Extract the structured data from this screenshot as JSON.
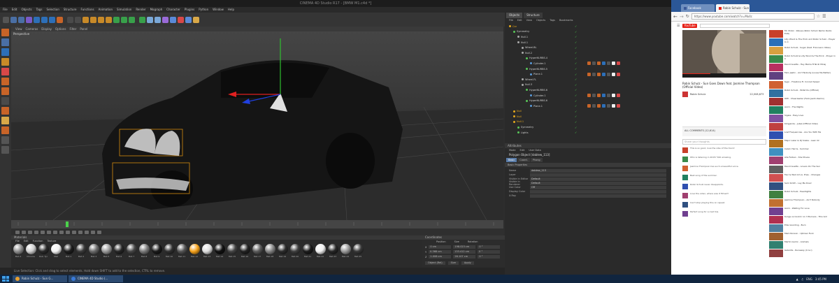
{
  "c4d": {
    "title": "CINEMA 4D Studio R17 - [BMW M1.c4d *]",
    "menu": [
      "File",
      "Edit",
      "Objects",
      "Tags",
      "Selection",
      "Structure",
      "Functions",
      "Animation",
      "Simulation",
      "Render",
      "Mograph",
      "Character",
      "Plugins",
      "Python",
      "Window",
      "Help"
    ],
    "viewport_menu": [
      "View",
      "Cameras",
      "Display",
      "Options",
      "Filter",
      "Panel"
    ],
    "viewport_label": "Perspective",
    "status": "Live Selection: Click and drag to select elements. Hold down SHIFT to add to the selection, CTRL to remove."
  },
  "object_manager": {
    "tabs": [
      "Objects",
      "Structure"
    ],
    "menu": [
      "File",
      "Edit",
      "View",
      "Objects",
      "Tags",
      "Bookmarks"
    ],
    "rows": [
      {
        "label": "Car",
        "indent": 1,
        "color": "#e5a81c"
      },
      {
        "label": "Symmetry",
        "indent": 2,
        "color": "#58c658"
      },
      {
        "label": "Null.1",
        "indent": 3,
        "color": "#aaaaaa"
      },
      {
        "label": "Null.1",
        "indent": 3,
        "color": "#aaaaaa"
      },
      {
        "label": "Wheel.BL",
        "indent": 4,
        "color": "#aaaaaa"
      },
      {
        "label": "Null.2",
        "indent": 4,
        "color": "#aaaaaa"
      },
      {
        "label": "HyperNURBS.4",
        "indent": 5,
        "color": "#58c658"
      },
      {
        "label": "Cylinder.1",
        "indent": 6,
        "color": "#5a9ad8"
      },
      {
        "label": "HyperNURBS.5",
        "indent": 5,
        "color": "#58c658"
      },
      {
        "label": "Plane.1",
        "indent": 6,
        "color": "#5a9ad8"
      },
      {
        "label": "Wheel.FL",
        "indent": 4,
        "color": "#aaaaaa"
      },
      {
        "label": "Null.3",
        "indent": 4,
        "color": "#aaaaaa"
      },
      {
        "label": "HyperNURBS.6",
        "indent": 5,
        "color": "#58c658"
      },
      {
        "label": "Cylinder.1",
        "indent": 6,
        "color": "#5a9ad8"
      },
      {
        "label": "HyperNURBS.6",
        "indent": 5,
        "color": "#58c658"
      },
      {
        "label": "Plane.1",
        "indent": 6,
        "color": "#5a9ad8"
      },
      {
        "label": "Null",
        "indent": 2,
        "color": "#e5a81c"
      },
      {
        "label": "Null",
        "indent": 2,
        "color": "#e5a81c"
      },
      {
        "label": "Null.1",
        "indent": 2,
        "color": "#e5a81c"
      },
      {
        "label": "Symmetry",
        "indent": 3,
        "color": "#58c658"
      },
      {
        "label": "Lights",
        "indent": 3,
        "color": "#58c658"
      }
    ]
  },
  "attribute_manager": {
    "header": "Attributes",
    "menu": [
      "Mode",
      "Edit",
      "User Data"
    ],
    "object": "Polygon Object [dablew_113]",
    "tabs": [
      "Basic",
      "Coord.",
      "Phong"
    ],
    "section": "Basic Properties",
    "fields": [
      {
        "k": "Name",
        "v": "dablew_113"
      },
      {
        "k": "Layer",
        "v": ""
      },
      {
        "k": "Visible in Editor",
        "v": "Default"
      },
      {
        "k": "Visible in Renderer",
        "v": "Default"
      },
      {
        "k": "Use Color",
        "v": "Off"
      },
      {
        "k": "Display Color",
        "v": ""
      },
      {
        "k": "X-Ray",
        "v": ""
      }
    ]
  },
  "materials": {
    "header": "Materials",
    "menu": [
      "File",
      "Edit",
      "Function",
      "Texture"
    ],
    "items": [
      {
        "name": "Mat.4",
        "color": "#8e8e8e"
      },
      {
        "name": "Chrome",
        "color": "#cfcfcf"
      },
      {
        "name": "Rub. Tyr",
        "color": "#2a2a2a"
      },
      {
        "name": "Mat",
        "color": "#f2f2f2"
      },
      {
        "name": "Mat.1",
        "color": "#1e1e1e"
      },
      {
        "name": "Mat.2",
        "color": "#3a3a3a"
      },
      {
        "name": "Mat.3",
        "color": "#6a6a6a"
      },
      {
        "name": "Mat.5",
        "color": "#9a9a9a"
      },
      {
        "name": "Mat.6",
        "color": "#262626"
      },
      {
        "name": "Mat.7",
        "color": "#464646"
      },
      {
        "name": "Mat.8",
        "color": "#7a7a7a"
      },
      {
        "name": "Mat.9",
        "color": "#1a1a1a"
      },
      {
        "name": "Mat.10",
        "color": "#303030"
      },
      {
        "name": "Mat.11",
        "color": "#555555"
      },
      {
        "name": "Mat.12",
        "color": "#f5a21c"
      },
      {
        "name": "Mat.13",
        "color": "#dddddd"
      },
      {
        "name": "Mat.14",
        "color": "#111111"
      },
      {
        "name": "Mat.15",
        "color": "#444444"
      },
      {
        "name": "Mat.16",
        "color": "#222222"
      },
      {
        "name": "Mat.17",
        "color": "#5c5c5c"
      },
      {
        "name": "Mat.18",
        "color": "#858585"
      },
      {
        "name": "Mat.19",
        "color": "#2c2c2c"
      },
      {
        "name": "Mat.20",
        "color": "#3e3e3e"
      },
      {
        "name": "Mat.21",
        "color": "#1c1c1c"
      },
      {
        "name": "Mat.22",
        "color": "#f0f0f0"
      },
      {
        "name": "Mat.23",
        "color": "#262626"
      },
      {
        "name": "Mat.24",
        "color": "#999999"
      },
      {
        "name": "Mat.25",
        "color": "#383838"
      }
    ]
  },
  "coordinates": {
    "header": "Coordinates",
    "cols": [
      "Position",
      "Size",
      "Rotation"
    ],
    "rows": [
      [
        "0 cm",
        "198.023 cm",
        "0 °"
      ],
      [
        "0.368 cm",
        "133.412 cm",
        "0 °"
      ],
      [
        "1.008 cm",
        "26.107 cm",
        "0 °"
      ]
    ],
    "mode": [
      "Object (Rel)",
      "Size",
      "Apply"
    ]
  },
  "chrome": {
    "tabs": [
      {
        "label": "Facebook",
        "active": false
      },
      {
        "label": "Robin Schulz - Sun Go",
        "active": true
      }
    ],
    "url": "https://www.youtube.com/watch?v=Mo4c",
    "video_title": "Robin Schulz - Sun Goes Down feat. Jasmine Thompson (Official Video)",
    "channel": "Robin Schulz",
    "views": "22,008,673",
    "comments_heading": "ALL COMMENTS (12,614)",
    "comment_placeholder": "Share your thoughts",
    "sidebar": [
      "Mr. Probz - Waves (Robin Schulz Remix Radio Edit)",
      "Lilly Wood & The Prick and Robin Schulz - Prayer In C",
      "Robin Schulz - Sugar (feat. Francesco Yates)",
      "Robin Schulz & Lilly Wood & The Prick - Prayer in C",
      "David Guetta - Hey Mama ft Nicki Minaj",
      "Felix Jaehn - Ain't Nobody (Loves Me Better)",
      "Kygo - Firestone ft. Conrad Sewell",
      "Robin Schulz - Willst Du (Official)",
      "OMI - Cheerleader (Felix Jaehn Remix)",
      "Avicii - The Nights",
      "Sigala - Easy Love",
      "Klingande - Jubel (Official Video)",
      "Lost Frequencies - Are You With Me",
      "Major Lazer & DJ Snake - Lean On",
      "Calvin Harris - Summer",
      "Alle Farben - She Moves",
      "David Guetta - Lovers On The Sun",
      "Faul & Wad Ad vs. Pnau - Changes",
      "Sam Smith - Lay Me Down",
      "Robin Schulz - Headlights",
      "Jasmine Thompson - Ain't Nobody",
      "Avicii - Waiting For Love",
      "Kungs vs Cookin' on 3 Burners - This Girl",
      "Ellie Goulding - Burn",
      "Mark Ronson - Uptown Funk",
      "Martin Garrix - Animals",
      "Galantis - Runaway (U & I)"
    ],
    "comments": [
      "This is so good, love the vibe of this track!",
      "Who is listening in 2015? Still amazing.",
      "Jasmine Thompson has such a beautiful voice.",
      "Best song of the summer.",
      "Robin Schulz never disappoints.",
      "Love the video, where was it filmed?",
      "Can't stop playing this on repeat.",
      "Perfect song for a road trip."
    ]
  },
  "taskbar": {
    "tasks": [
      "Robin Schulz - Sun G...",
      "CINEMA 4D Studio (..."
    ],
    "lang": "ENG",
    "time": "3:45 PM"
  }
}
